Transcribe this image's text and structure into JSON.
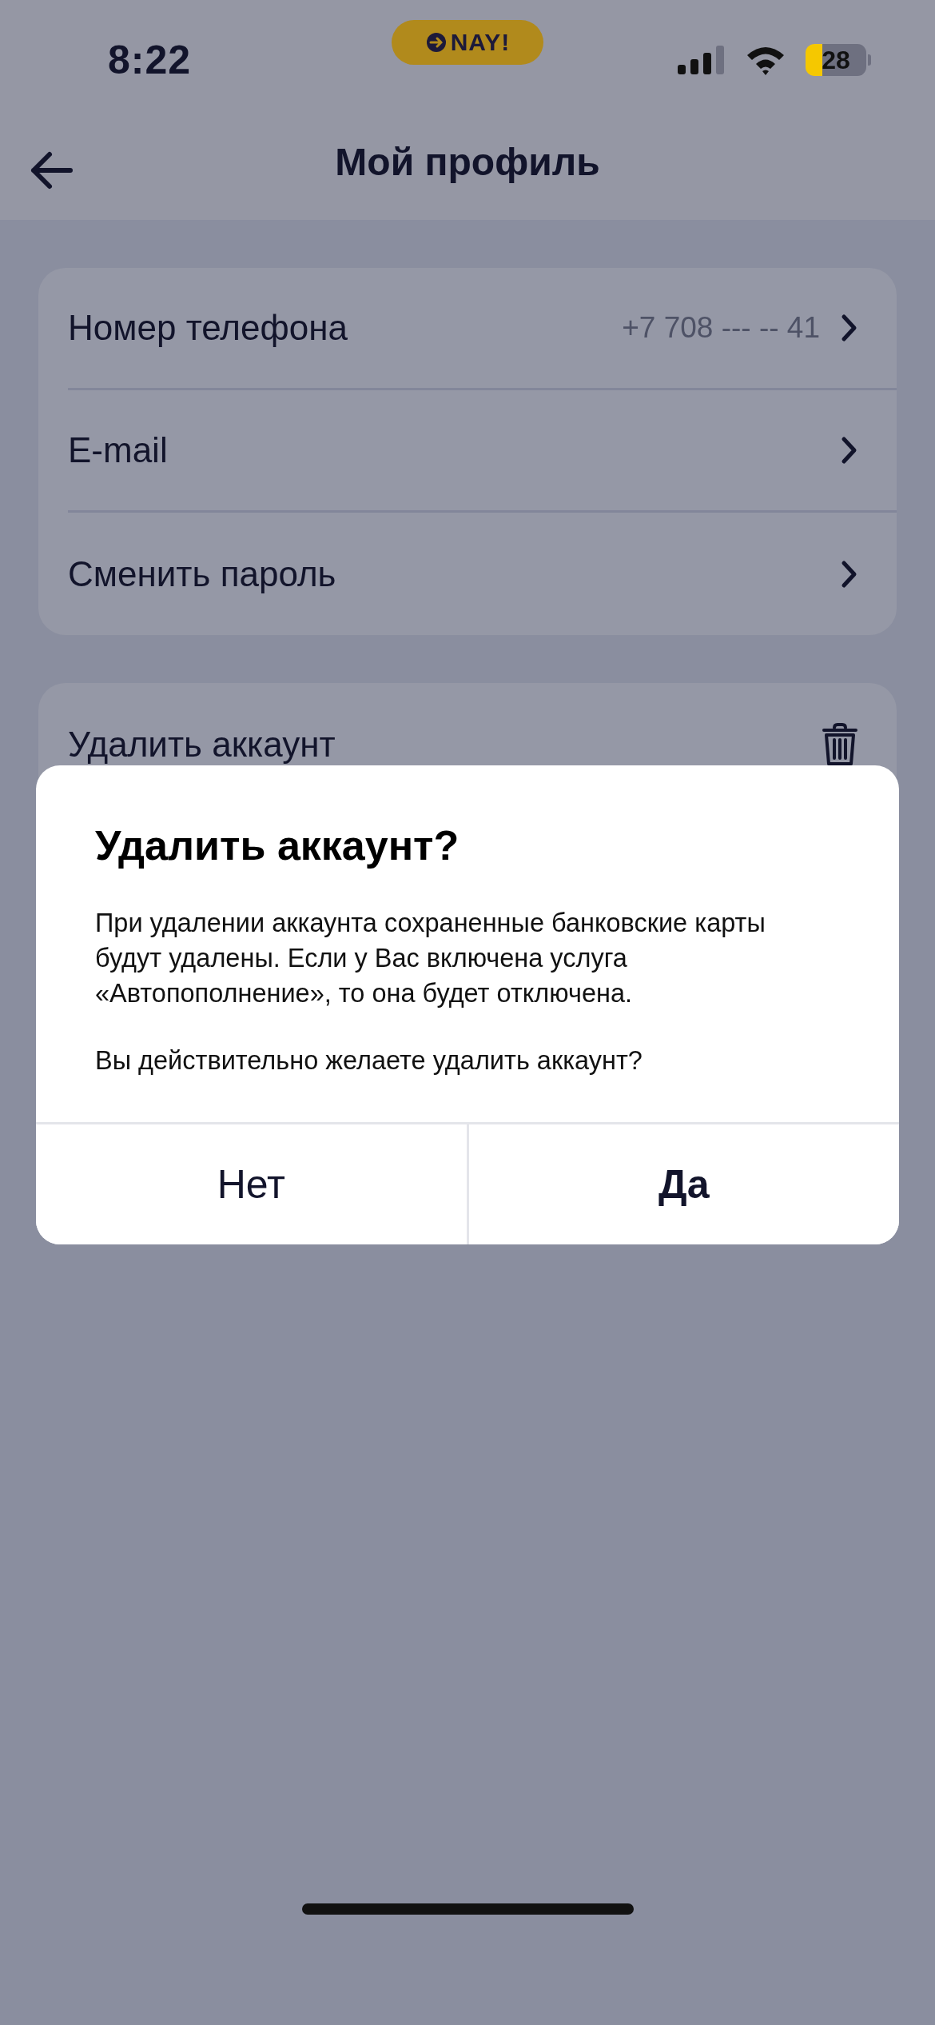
{
  "status_bar": {
    "time": "8:22",
    "app_badge": "NAY!",
    "battery": "28"
  },
  "header": {
    "title": "Мой профиль"
  },
  "settings": [
    {
      "label": "Номер телефона",
      "value": "+7 708 --- -- 41",
      "kind": "link"
    },
    {
      "label": "E-mail",
      "kind": "link"
    },
    {
      "label": "Сменить пароль",
      "kind": "link"
    }
  ],
  "danger": [
    {
      "label": "Удалить аккаунт",
      "kind": "delete"
    }
  ],
  "dialog": {
    "title": "Удалить аккаунт?",
    "paragraphs": [
      "При удалении аккаунта сохраненные банковские карты будут удалены. Если у Вас включена услуга «Автопополнение», то она будет отключена.",
      "Вы действительно желаете удалить аккаунт?"
    ],
    "buttons": [
      {
        "label": "Нет",
        "primary": false
      },
      {
        "label": "Да",
        "primary": true
      }
    ]
  }
}
